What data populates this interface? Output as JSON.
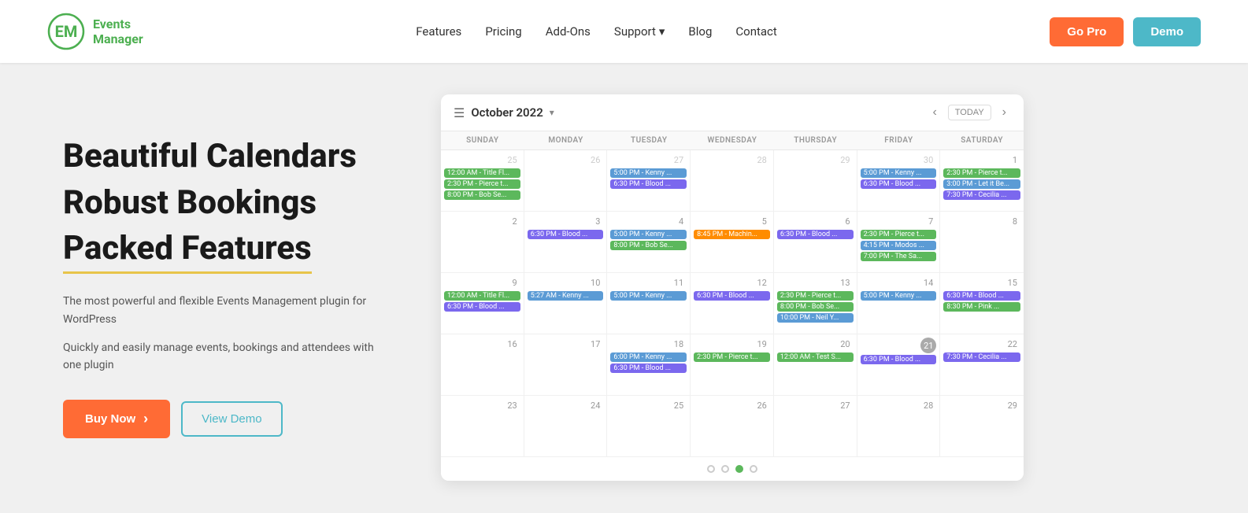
{
  "header": {
    "logo_text_line1": "Events",
    "logo_text_line2": "Manager",
    "nav": [
      {
        "label": "Features",
        "id": "features"
      },
      {
        "label": "Pricing",
        "id": "pricing"
      },
      {
        "label": "Add-Ons",
        "id": "addons"
      },
      {
        "label": "Support",
        "id": "support",
        "has_dropdown": true
      },
      {
        "label": "Blog",
        "id": "blog"
      },
      {
        "label": "Contact",
        "id": "contact"
      }
    ],
    "btn_gopro": "Go Pro",
    "btn_demo": "Demo"
  },
  "hero": {
    "line1": "Beautiful Calendars",
    "line2": "Robust Bookings",
    "line3": "Packed Features",
    "desc1": "The most powerful and flexible Events Management plugin for WordPress",
    "desc2": "Quickly and easily manage events, bookings and attendees with one plugin",
    "btn_buynow": "Buy Now",
    "btn_viewdemo": "View Demo"
  },
  "calendar": {
    "month_title": "October 2022",
    "today_label": "TODAY",
    "day_names": [
      "SUNDAY",
      "MONDAY",
      "TUESDAY",
      "WEDNESDAY",
      "THURSDAY",
      "FRIDAY",
      "SATURDAY"
    ],
    "weeks": [
      {
        "cells": [
          {
            "date": "25",
            "other": true,
            "events": [
              {
                "label": "12:00 AM - Title Fl...",
                "color": "green"
              },
              {
                "label": "2:30 PM - Pierce t...",
                "color": "green"
              },
              {
                "label": "8:00 PM - Bob Se...",
                "color": "green"
              }
            ]
          },
          {
            "date": "26",
            "other": true,
            "events": []
          },
          {
            "date": "27",
            "other": true,
            "events": [
              {
                "label": "5:00 PM - Kenny ...",
                "color": "blue"
              },
              {
                "label": "6:30 PM - Blood ...",
                "color": "purple"
              }
            ]
          },
          {
            "date": "28",
            "other": true,
            "events": []
          },
          {
            "date": "29",
            "other": true,
            "events": []
          },
          {
            "date": "30",
            "other": true,
            "events": [
              {
                "label": "5:00 PM - Kenny ...",
                "color": "blue"
              },
              {
                "label": "6:30 PM - Blood ...",
                "color": "purple"
              }
            ]
          },
          {
            "date": "1",
            "other": false,
            "events": [
              {
                "label": "2:30 PM - Pierce t...",
                "color": "green"
              },
              {
                "label": "3:00 PM - Let it Be...",
                "color": "blue"
              },
              {
                "label": "7:30 PM - Cecilia ...",
                "color": "purple"
              }
            ]
          }
        ]
      },
      {
        "cells": [
          {
            "date": "2",
            "other": false,
            "events": []
          },
          {
            "date": "3",
            "other": false,
            "events": [
              {
                "label": "6:30 PM - Blood ...",
                "color": "purple"
              }
            ]
          },
          {
            "date": "4",
            "other": false,
            "events": [
              {
                "label": "5:00 PM - Kenny ...",
                "color": "blue"
              },
              {
                "label": "8:00 PM - Bob Se...",
                "color": "green"
              }
            ]
          },
          {
            "date": "5",
            "other": false,
            "events": [
              {
                "label": "8:45 PM - Machin...",
                "color": "orange"
              }
            ]
          },
          {
            "date": "6",
            "other": false,
            "events": [
              {
                "label": "6:30 PM - Blood ...",
                "color": "purple"
              }
            ]
          },
          {
            "date": "7",
            "other": false,
            "events": [
              {
                "label": "2:30 PM - Pierce t...",
                "color": "green"
              },
              {
                "label": "4:15 PM - Modos ...",
                "color": "blue"
              },
              {
                "label": "7:00 PM - The Sa...",
                "color": "green"
              }
            ]
          },
          {
            "date": "8",
            "other": false,
            "events": []
          }
        ]
      },
      {
        "cells": [
          {
            "date": "9",
            "other": false,
            "events": [
              {
                "label": "12:00 AM - Title Fl...",
                "color": "green"
              },
              {
                "label": "6:30 PM - Blood ...",
                "color": "purple"
              }
            ]
          },
          {
            "date": "10",
            "other": false,
            "events": [
              {
                "label": "5:27 AM - Kenny ...",
                "color": "blue"
              }
            ]
          },
          {
            "date": "11",
            "other": false,
            "events": [
              {
                "label": "5:00 PM - Kenny ...",
                "color": "blue"
              }
            ]
          },
          {
            "date": "12",
            "other": false,
            "events": [
              {
                "label": "6:30 PM - Blood ...",
                "color": "purple"
              }
            ]
          },
          {
            "date": "13",
            "other": false,
            "events": [
              {
                "label": "2:30 PM - Pierce t...",
                "color": "green"
              },
              {
                "label": "8:00 PM - Bob Se...",
                "color": "green"
              },
              {
                "label": "10:00 PM - Neil Y...",
                "color": "blue"
              }
            ]
          },
          {
            "date": "14",
            "other": false,
            "events": [
              {
                "label": "5:00 PM - Kenny ...",
                "color": "blue"
              }
            ]
          },
          {
            "date": "15",
            "other": false,
            "events": [
              {
                "label": "6:30 PM - Blood ...",
                "color": "purple"
              },
              {
                "label": "8:30 PM - Pink ...",
                "color": "green"
              }
            ]
          }
        ]
      },
      {
        "cells": [
          {
            "date": "16",
            "other": false,
            "events": []
          },
          {
            "date": "17",
            "other": false,
            "events": []
          },
          {
            "date": "18",
            "other": false,
            "events": [
              {
                "label": "6:00 PM - Kenny ...",
                "color": "blue"
              },
              {
                "label": "6:30 PM - Blood ...",
                "color": "purple"
              }
            ]
          },
          {
            "date": "19",
            "other": false,
            "events": [
              {
                "label": "2:30 PM - Pierce t...",
                "color": "green"
              }
            ]
          },
          {
            "date": "20",
            "other": false,
            "events": [
              {
                "label": "12:00 AM - Test S...",
                "color": "green"
              }
            ]
          },
          {
            "date": "21",
            "other": false,
            "today": true,
            "events": [
              {
                "label": "6:30 PM - Blood ...",
                "color": "purple"
              }
            ]
          },
          {
            "date": "22",
            "other": false,
            "events": [
              {
                "label": "7:30 PM - Cecilia ...",
                "color": "purple"
              }
            ]
          }
        ]
      },
      {
        "cells": [
          {
            "date": "23",
            "other": false,
            "events": []
          },
          {
            "date": "24",
            "other": false,
            "events": []
          },
          {
            "date": "25",
            "other": false,
            "events": []
          },
          {
            "date": "26",
            "other": false,
            "events": []
          },
          {
            "date": "27",
            "other": false,
            "events": []
          },
          {
            "date": "28",
            "other": false,
            "events": []
          },
          {
            "date": "29",
            "other": false,
            "events": []
          }
        ]
      }
    ],
    "dots": [
      {
        "active": false
      },
      {
        "active": false
      },
      {
        "active": true
      },
      {
        "active": false
      }
    ]
  }
}
